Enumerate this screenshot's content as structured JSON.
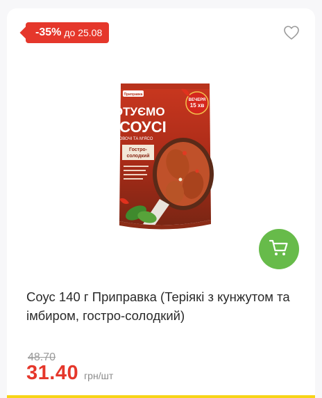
{
  "badge": {
    "discount": "-35%",
    "until": "до 25.08"
  },
  "product": {
    "image_icon": "sauce-packet-image",
    "package_text": {
      "brand": "Приправка",
      "line1": "ГОТУЄМО",
      "line2": "У СОУСІ",
      "line3": "ОВОЧІ ТА М'ЯСО",
      "flavor1": "Гостро-",
      "flavor2": "солодкий",
      "sticker1": "ВЕЧЕРЯ",
      "sticker2": "15 хв"
    },
    "title": "Соус 140 г Приправка (Теріякі з кунжутом та імбиром, гостро-солодкий)",
    "old_price": "48.70",
    "price": "31.40",
    "unit": "грн/шт"
  },
  "colors": {
    "accent_red": "#e5372b",
    "cart_green": "#67bb4a",
    "bottom_yellow": "#f7d417"
  },
  "icons": {
    "favorite": "heart-icon",
    "cart": "cart-icon"
  }
}
